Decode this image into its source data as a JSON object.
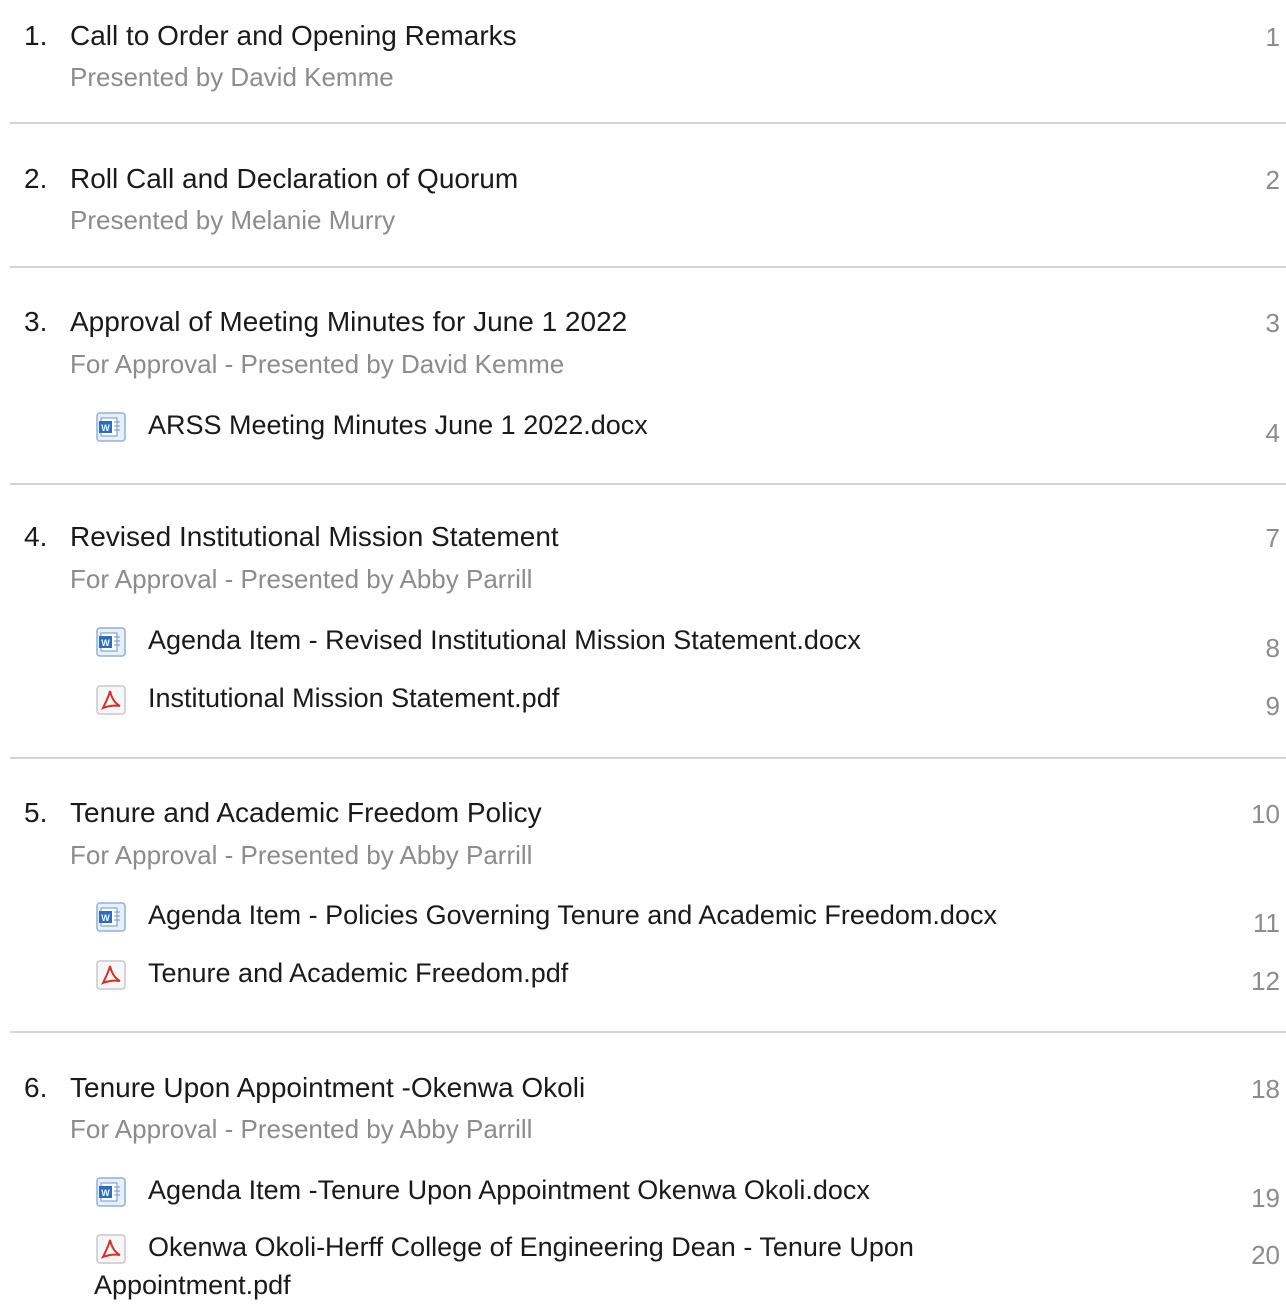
{
  "agenda": {
    "items": [
      {
        "number": "1.",
        "title": "Call to Order and Opening Remarks",
        "subtitle": "Presented by David Kemme",
        "page": "1",
        "attachments": []
      },
      {
        "number": "2.",
        "title": "Roll Call and Declaration of Quorum",
        "subtitle": "Presented by Melanie Murry",
        "page": "2",
        "attachments": []
      },
      {
        "number": "3.",
        "title": "Approval of Meeting Minutes for June 1 2022",
        "subtitle": "For Approval - Presented by David Kemme",
        "page": "3",
        "attachments": [
          {
            "icon": "word-document-icon",
            "name": "ARSS Meeting Minutes June 1 2022.docx",
            "page": "4"
          }
        ]
      },
      {
        "number": "4.",
        "title": "Revised Institutional Mission Statement",
        "subtitle": "For Approval - Presented by Abby Parrill",
        "page": "7",
        "attachments": [
          {
            "icon": "word-document-icon",
            "name": "Agenda Item - Revised Institutional Mission Statement.docx",
            "page": "8"
          },
          {
            "icon": "pdf-document-icon",
            "name": "Institutional Mission Statement.pdf",
            "page": "9"
          }
        ]
      },
      {
        "number": "5.",
        "title": "Tenure and Academic Freedom Policy",
        "subtitle": "For Approval - Presented by Abby Parrill",
        "page": "10",
        "attachments": [
          {
            "icon": "word-document-icon",
            "name": "Agenda Item - Policies Governing Tenure and Academic Freedom.docx",
            "page": "11"
          },
          {
            "icon": "pdf-document-icon",
            "name": "Tenure and Academic Freedom.pdf",
            "page": "12"
          }
        ]
      },
      {
        "number": "6.",
        "title": "Tenure Upon Appointment -Okenwa Okoli",
        "subtitle": "For Approval - Presented by Abby Parrill",
        "page": "18",
        "attachments": [
          {
            "icon": "word-document-icon",
            "name": "Agenda Item -Tenure Upon Appointment Okenwa Okoli.docx",
            "page": "19"
          },
          {
            "icon": "pdf-document-icon",
            "name": "Okenwa Okoli-Herff College of Engineering Dean - Tenure Upon",
            "name_cont": "Appointment.pdf",
            "page": "20"
          }
        ]
      }
    ]
  },
  "colors": {
    "text": "#1a1a1a",
    "muted": "#8c8c8c",
    "divider": "#d4d4d4",
    "word_blue": "#2b6cc4",
    "pdf_red": "#d93025"
  }
}
